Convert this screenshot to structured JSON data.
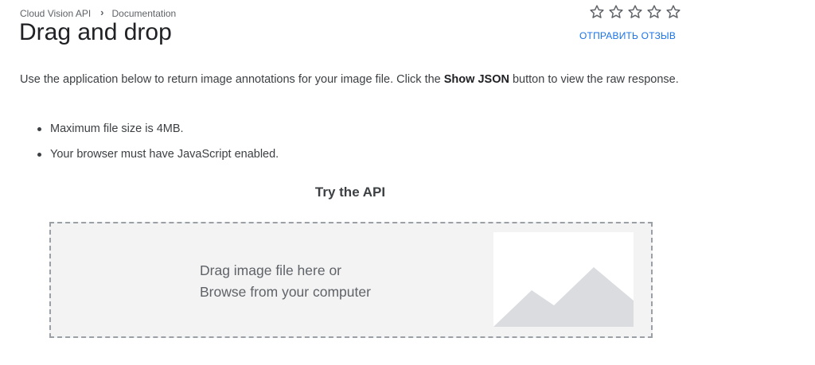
{
  "breadcrumb": {
    "items": [
      "Cloud Vision API",
      "Documentation"
    ],
    "separator": "›"
  },
  "page": {
    "title": "Drag and drop"
  },
  "rating": {
    "stars_total": 5,
    "stars_filled": 0,
    "feedback_label": "ОТПРАВИТЬ ОТЗЫВ"
  },
  "intro": {
    "text_before": "Use the application below to return image annotations for your image file. Click the ",
    "bold": "Show JSON",
    "text_after": " button to view the raw response."
  },
  "bullets": [
    "Maximum file size is 4MB.",
    "Your browser must have JavaScript enabled."
  ],
  "try_api": {
    "heading": "Try the API",
    "drop_line1": "Drag image file here or",
    "drop_line2": "Browse from your computer",
    "placeholder_icon": "image-placeholder-icon"
  },
  "colors": {
    "accent": "#1a73e8",
    "star_outline": "#5f6368",
    "dropzone_bg": "#f3f3f3",
    "dropzone_border": "#9aa0a6",
    "mountain": "#dadce0"
  }
}
